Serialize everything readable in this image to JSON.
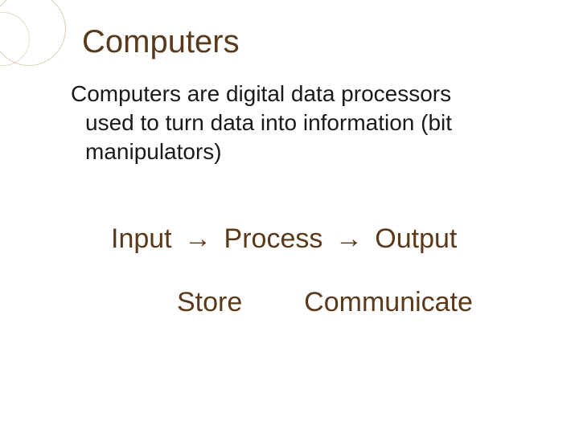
{
  "title": "Computers",
  "body_first": "Computers are digital data processors",
  "body_rest1": "used to turn data into information (bit",
  "body_rest2": "manipulators)",
  "ipo": {
    "w1": "Input",
    "arrow": "→",
    "w2": "Process",
    "w3": "Output"
  },
  "sc": {
    "w1": "Store",
    "w2": "Communicate"
  }
}
